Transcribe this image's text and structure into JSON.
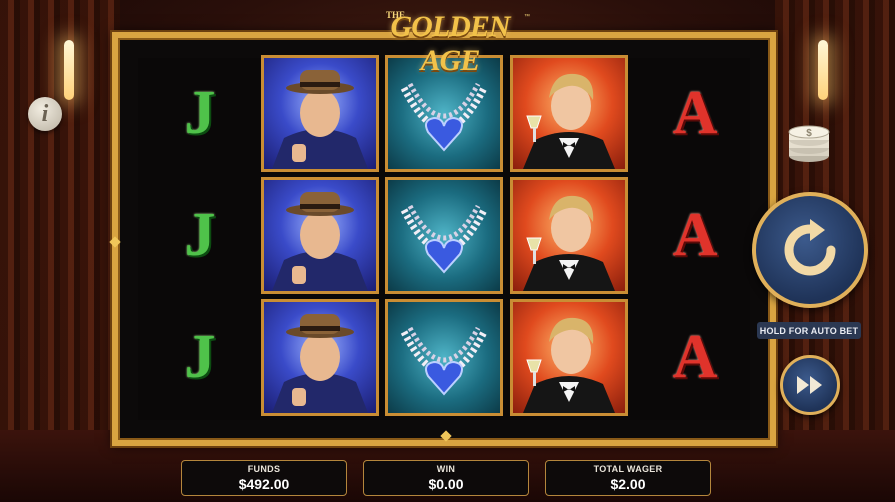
{
  "game": {
    "title_prefix": "THE",
    "title_main": "GOLDEN AGE",
    "title_tm": "™"
  },
  "reels": [
    [
      "J",
      "J",
      "J"
    ],
    [
      "gentleman-with-hat",
      "gentleman-with-hat",
      "gentleman-with-hat"
    ],
    [
      "heart-diamond-necklace",
      "heart-diamond-necklace",
      "heart-diamond-necklace"
    ],
    [
      "man-in-tuxedo-with-glass",
      "man-in-tuxedo-with-glass",
      "man-in-tuxedo-with-glass"
    ],
    [
      "A",
      "A",
      "A"
    ]
  ],
  "controls": {
    "info_label": "i",
    "hold_label": "HOLD FOR AUTO BET"
  },
  "stats": {
    "funds_label": "FUNDS",
    "funds_value": "$492.00",
    "win_label": "WIN",
    "win_value": "$0.00",
    "wager_label": "TOTAL WAGER",
    "wager_value": "$2.00"
  },
  "colors": {
    "gold": "#d9a441",
    "button_blue": "#1f3358",
    "j_green": "#4fc24a",
    "a_red": "#e0332b"
  }
}
